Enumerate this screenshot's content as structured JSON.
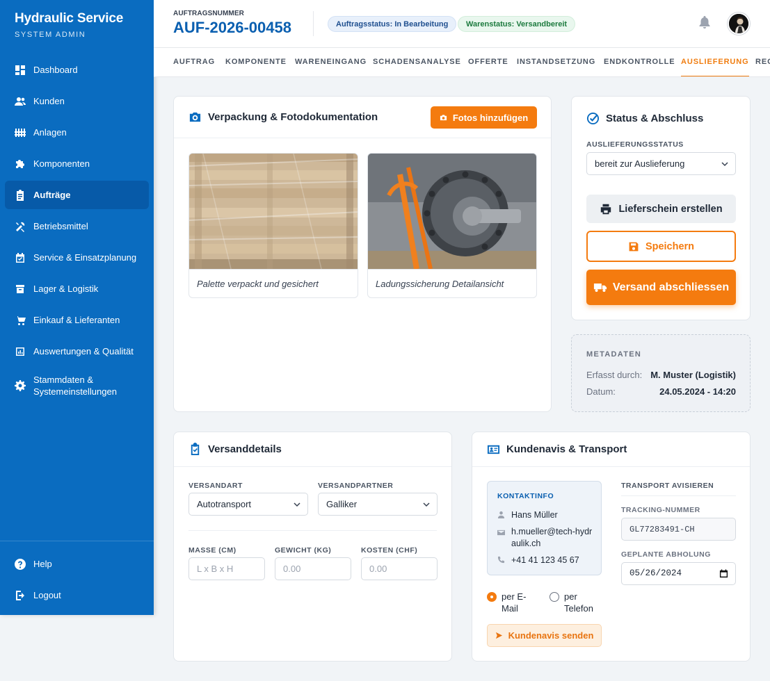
{
  "brand": {
    "title": "Hydraulic Service",
    "subtitle": "SYSTEM ADMIN"
  },
  "sidebar": {
    "items": [
      {
        "label": "Dashboard",
        "icon": "dashboard-icon"
      },
      {
        "label": "Kunden",
        "icon": "users-icon"
      },
      {
        "label": "Anlagen",
        "icon": "factory-icon"
      },
      {
        "label": "Komponenten",
        "icon": "puzzle-icon"
      },
      {
        "label": "Aufträge",
        "icon": "clipboard-icon",
        "active": true
      },
      {
        "label": "Betriebsmittel",
        "icon": "tools-icon"
      },
      {
        "label": "Service & Einsatzplanung",
        "icon": "calendar-icon"
      },
      {
        "label": "Lager & Logistik",
        "icon": "warehouse-icon"
      },
      {
        "label": "Einkauf & Lieferanten",
        "icon": "cart-icon"
      },
      {
        "label": "Auswertungen & Qualität",
        "icon": "chart-icon"
      },
      {
        "label": "Stammdaten & Systemeinstellungen",
        "icon": "gear-icon"
      }
    ],
    "bottom": [
      {
        "label": "Help",
        "icon": "help-icon"
      },
      {
        "label": "Logout",
        "icon": "logout-icon"
      }
    ]
  },
  "header": {
    "order_label": "AUFTRAGSNUMMER",
    "order_number": "AUF-2026-00458",
    "status_badge": "Auftragsstatus: In Bearbeitung",
    "goods_badge": "Warenstatus: Versandbereit"
  },
  "tabs": [
    "Auftrag",
    "Komponente",
    "Wareneingang",
    "Schadensanalyse",
    "Offerte",
    "Instandsetzung",
    "Endkontrolle",
    "Auslieferung",
    "Rechnung"
  ],
  "active_tab": "Auslieferung",
  "packaging": {
    "title": "Verpackung & Fotodokumentation",
    "add_photos": "Fotos hinzufügen",
    "photos": [
      {
        "caption": "Palette verpackt und gesichert"
      },
      {
        "caption": "Ladungssicherung Detailansicht"
      }
    ]
  },
  "status": {
    "title": "Status & Abschluss",
    "delivery_status_label": "AUSLIEFERUNGSSTATUS",
    "delivery_status_value": "bereit zur Auslieferung",
    "delivery_note_btn": "Lieferschein erstellen",
    "save_btn": "Speichern",
    "finish_btn": "Versand abschliessen"
  },
  "metadata": {
    "title": "METADATEN",
    "captured_by_label": "Erfasst durch:",
    "captured_by_value": "M. Muster (Logistik)",
    "date_label": "Datum:",
    "date_value": "24.05.2024 - 14:20"
  },
  "shipping": {
    "title": "Versanddetails",
    "method_label": "VERSANDART",
    "method_value": "Autotransport",
    "partner_label": "VERSANDPARTNER",
    "partner_value": "Galliker",
    "dimensions_label": "MASSE (CM)",
    "dimensions_placeholder": "L x B x H",
    "weight_label": "GEWICHT (KG)",
    "weight_placeholder": "0.00",
    "cost_label": "KOSTEN (CHF)",
    "cost_placeholder": "0.00"
  },
  "notice": {
    "title": "Kundenavis & Transport",
    "contact_title": "KONTAKTINFO",
    "contact_name": "Hans Müller",
    "contact_email": "h.mueller@tech-hydraulik.ch",
    "contact_phone": "+41 41 123 45 67",
    "radio_email": "per E-Mail",
    "radio_phone": "per Telefon",
    "send_btn": "Kundenavis senden",
    "transport_title": "TRANSPORT AVISIEREN",
    "tracking_label": "TRACKING-NUMMER",
    "tracking_value": "GL77283491-CH",
    "pickup_label": "GEPLANTE ABHOLUNG",
    "pickup_value": "05/26/2024"
  },
  "colors": {
    "brand": "#0a6cc0",
    "accent": "#f47b0f"
  }
}
